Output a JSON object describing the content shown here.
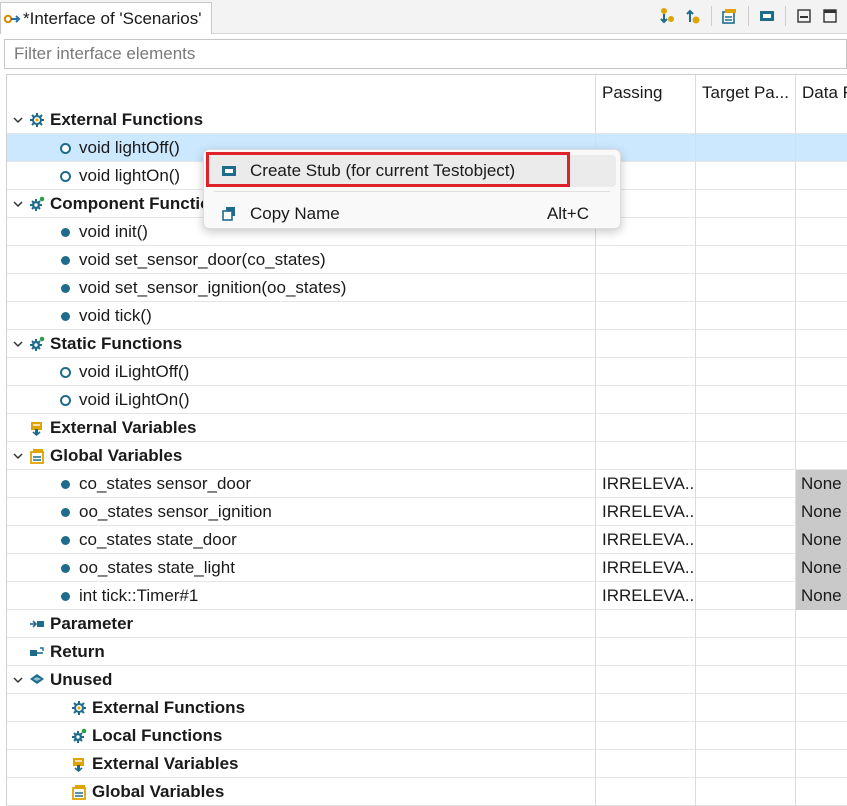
{
  "tab": {
    "title": "*Interface of 'Scenarios'"
  },
  "toolbar": {
    "icons": [
      "move-down-icon",
      "move-up-icon",
      "global-var-icon",
      "stub-icon",
      "minimize-icon",
      "maximize-icon"
    ]
  },
  "filter": {
    "placeholder": "Filter interface elements",
    "value": ""
  },
  "columns": {
    "name": "",
    "passing": "Passing",
    "target_passing": "Target Pa...",
    "data": "Data F"
  },
  "rows": [
    {
      "label": "External Functions",
      "bold": true,
      "icon": "external-functions-icon",
      "expanded": true
    },
    {
      "label": "void lightOff()",
      "dot": "open",
      "selected": true
    },
    {
      "label": "void lightOn()",
      "dot": "open"
    },
    {
      "label": "Component Functions",
      "bold": true,
      "icon": "component-functions-icon",
      "expanded": true
    },
    {
      "label": "void init()",
      "dot": "filled"
    },
    {
      "label": "void set_sensor_door(co_states)",
      "dot": "filled"
    },
    {
      "label": "void set_sensor_ignition(oo_states)",
      "dot": "filled"
    },
    {
      "label": "void tick()",
      "dot": "filled"
    },
    {
      "label": "Static Functions",
      "bold": true,
      "icon": "static-functions-icon",
      "expanded": true
    },
    {
      "label": "void iLightOff()",
      "dot": "open"
    },
    {
      "label": "void iLightOn()",
      "dot": "open"
    },
    {
      "label": "External Variables",
      "bold": true,
      "icon": "external-variables-icon"
    },
    {
      "label": "Global Variables",
      "bold": true,
      "icon": "global-variables-icon",
      "expanded": true
    },
    {
      "label": "co_states sensor_door",
      "dot": "filled",
      "passing": "IRRELEVA...",
      "data": "None"
    },
    {
      "label": "oo_states sensor_ignition",
      "dot": "filled",
      "passing": "IRRELEVA...",
      "data": "None"
    },
    {
      "label": "co_states state_door",
      "dot": "filled",
      "passing": "IRRELEVA...",
      "data": "None"
    },
    {
      "label": "oo_states state_light",
      "dot": "filled",
      "passing": "IRRELEVA...",
      "data": "None"
    },
    {
      "label": "int tick::Timer#1",
      "dot": "filled",
      "passing": "IRRELEVA...",
      "data": "None"
    },
    {
      "label": "Parameter",
      "bold": true,
      "icon": "parameter-icon"
    },
    {
      "label": "Return",
      "bold": true,
      "icon": "return-icon"
    },
    {
      "label": "Unused",
      "bold": true,
      "icon": "unused-icon",
      "expanded": true
    },
    {
      "label": "External Functions",
      "bold": true,
      "icon": "external-functions-icon",
      "indent": true
    },
    {
      "label": "Local Functions",
      "bold": true,
      "icon": "component-functions-icon",
      "indent": true
    },
    {
      "label": "External Variables",
      "bold": true,
      "icon": "external-variables-icon",
      "indent": true
    },
    {
      "label": "Global Variables",
      "bold": true,
      "icon": "global-variables-icon",
      "indent": true
    }
  ],
  "context_menu": {
    "items": [
      {
        "label": "Create Stub (for current Testobject)",
        "shortcut": "",
        "icon": "stub-icon"
      },
      {
        "label": "Copy Name",
        "shortcut": "Alt+C",
        "icon": "copy-icon"
      }
    ]
  },
  "colors": {
    "selection": "#cce8ff",
    "highlight": "#e0202a",
    "accent": "#1f6b8c"
  }
}
